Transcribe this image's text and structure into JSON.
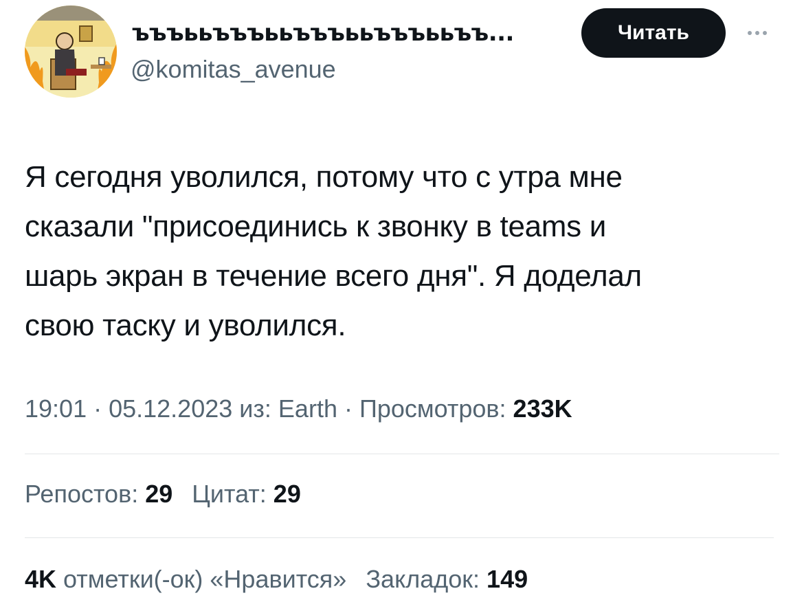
{
  "header": {
    "display_name": "ъъъььъъъььъъъььъъъььъъ...",
    "handle": "@komitas_avenue",
    "follow_label": "Читать"
  },
  "tweet": {
    "text": "Я сегодня уволился, потому что с утра мне\nсказали \"присоединись к звонку в teams и\nшарь экран в течение всего дня\". Я доделал\nсвою таску и уволился."
  },
  "meta": {
    "time": "19:01",
    "separator": "·",
    "date": "05.12.2023",
    "source_label": "из: Earth",
    "views_label": "Просмотров:",
    "views_count": "233K"
  },
  "stats": {
    "reposts_label": "Репостов:",
    "reposts_count": "29",
    "quotes_label": "Цитат:",
    "quotes_count": "29",
    "likes_count": "4K",
    "likes_label": "отметки(-ок) «Нравится»",
    "bookmarks_label": "Закладок:",
    "bookmarks_count": "149"
  },
  "icons": {
    "more": "more-horizontal-icon"
  },
  "colors": {
    "text_primary": "#0f1419",
    "text_secondary": "#536471",
    "button_bg": "#0f1419",
    "divider": "#e3e6e8"
  }
}
